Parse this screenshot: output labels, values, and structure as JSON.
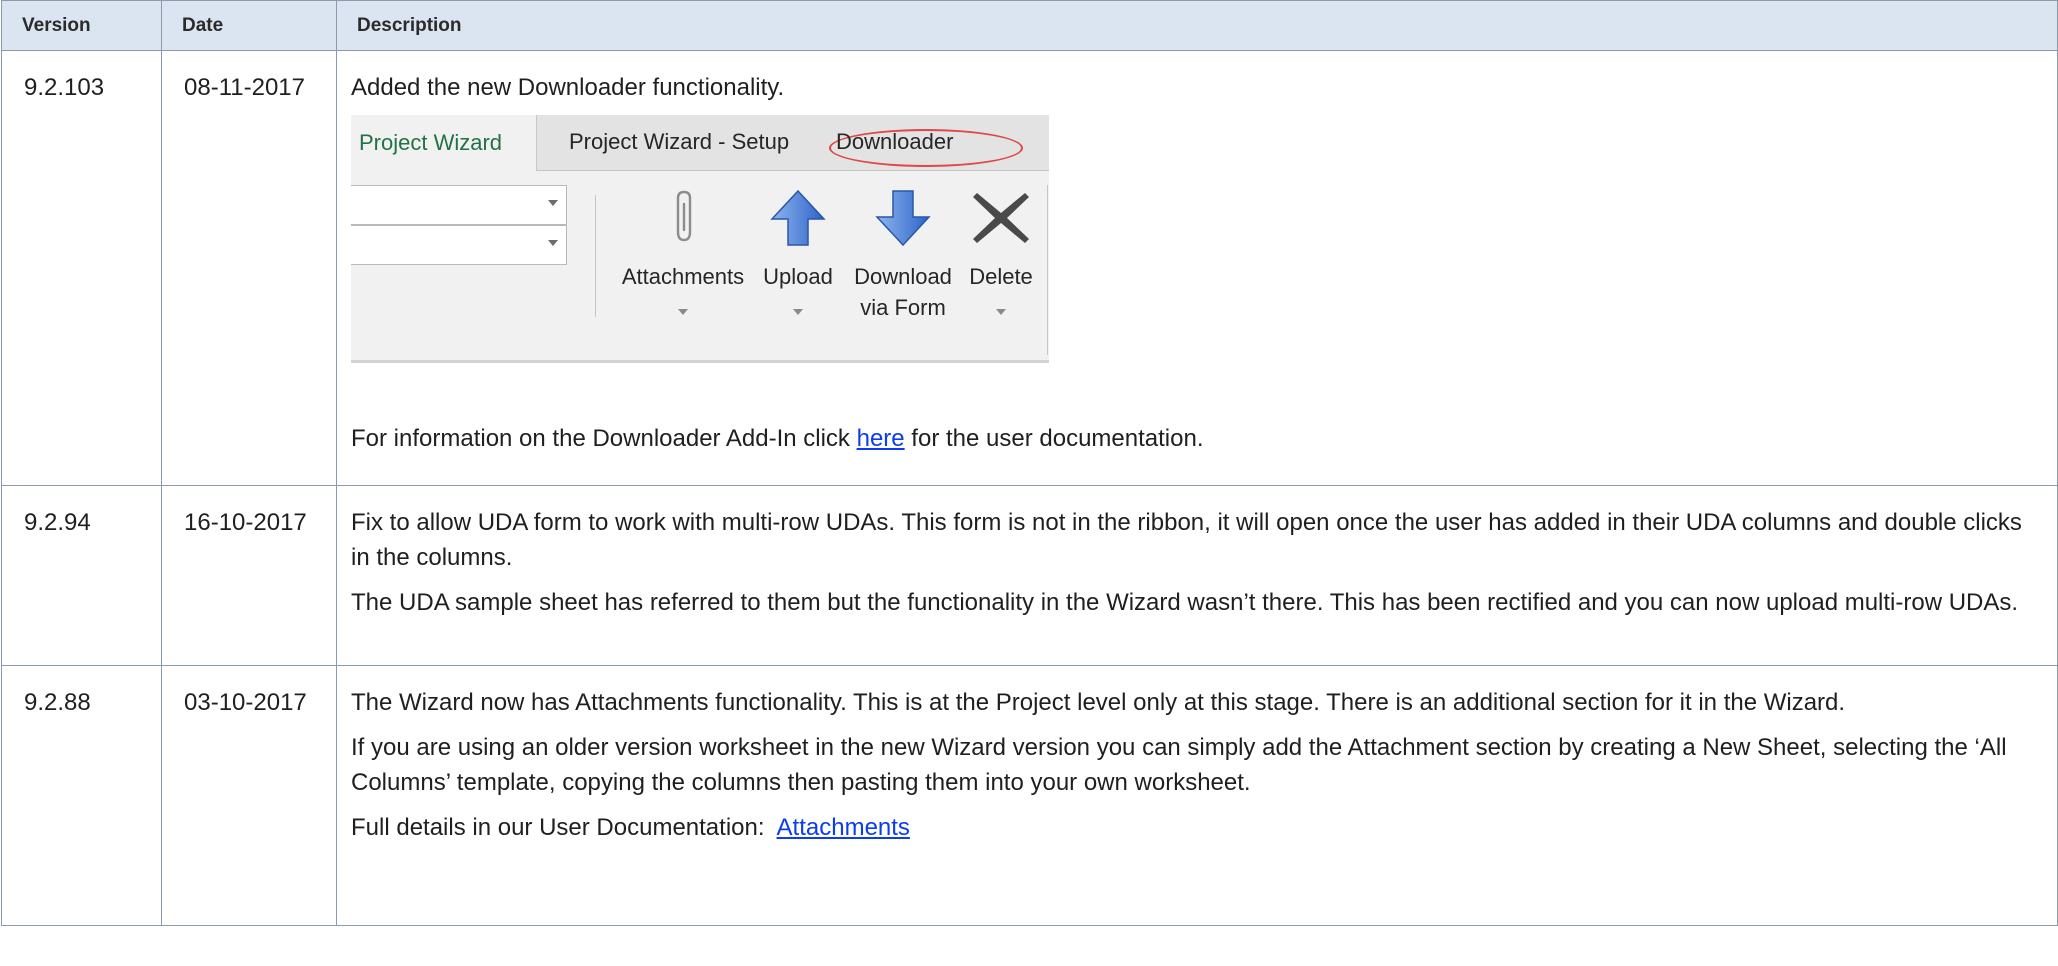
{
  "table": {
    "headers": {
      "version": "Version",
      "date": "Date",
      "description": "Description"
    },
    "rows": [
      {
        "version": "9.2.103",
        "date": "08-11-2017",
        "line1": "Added the new Downloader functionality.",
        "info_before": "For information on the Downloader Add-In click ",
        "info_link": "here",
        "info_after": " for the user documentation."
      },
      {
        "version": "9.2.94",
        "date": "16-10-2017",
        "para1": "Fix to allow UDA form to work with multi-row UDAs.  This form is not in the ribbon, it will open once the user has added in their UDA columns and double clicks in the columns.",
        "para2": "The UDA sample sheet has referred to them but the functionality in the Wizard wasn’t there.  This has been rectified and you can now upload multi-row UDAs."
      },
      {
        "version": "9.2.88",
        "date": "03-10-2017",
        "para1": "The Wizard now has Attachments functionality.  This is at the Project level only at this stage.  There is an additional section for it in the Wizard.",
        "para2": "If you are using an older version worksheet in the new Wizard version you can simply add the Attachment section by creating a New Sheet, selecting the ‘All Columns’ template, copying the columns then pasting them into your own worksheet.",
        "para3_before": "Full details in our User Documentation:  ",
        "para3_link": "Attachments"
      }
    ]
  },
  "ribbon": {
    "tabs": [
      "Project Wizard",
      "Project Wizard - Setup",
      "Downloader"
    ],
    "active_tab": "Project Wizard",
    "highlighted_tab": "Downloader",
    "buttons": [
      {
        "line1": "Attachments",
        "line2": "",
        "icon": "paperclip-icon",
        "dropdown": true
      },
      {
        "line1": "Upload",
        "line2": "",
        "icon": "upload-arrow-icon",
        "dropdown": true
      },
      {
        "line1": "Download",
        "line2": "via Form",
        "icon": "download-arrow-icon",
        "dropdown": false
      },
      {
        "line1": "Delete",
        "line2": "",
        "icon": "delete-x-icon",
        "dropdown": true
      }
    ]
  },
  "colors": {
    "header_bg": "#dbe5f1",
    "border": "#8a9bb0",
    "link": "#0b3cf0",
    "active_tab_text": "#217346",
    "highlight_oval": "#e04848",
    "arrow_blue": "#3f78d8"
  }
}
